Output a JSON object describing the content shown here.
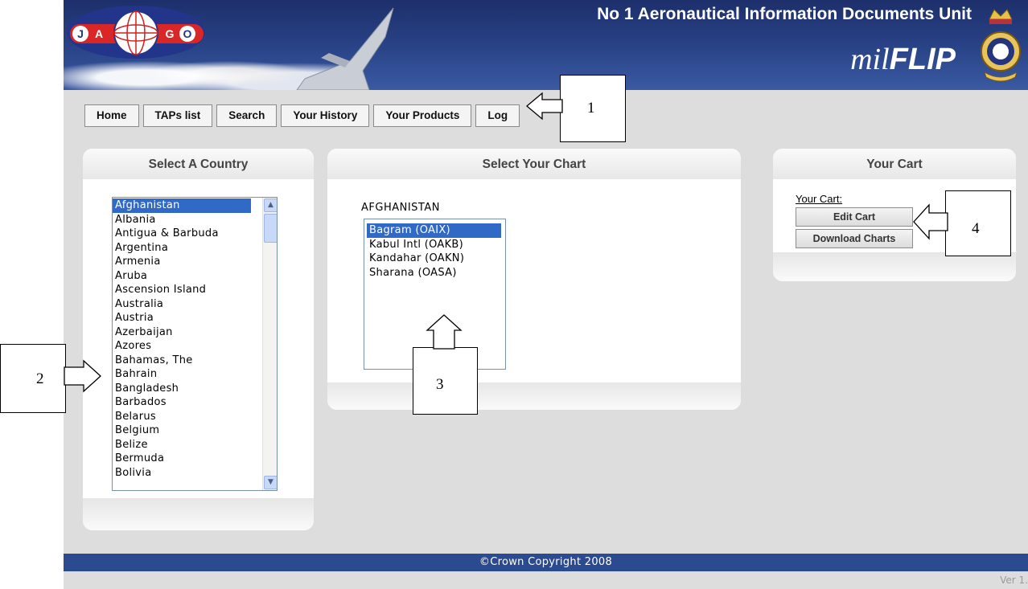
{
  "header": {
    "logo_letters": [
      "J",
      "A",
      "G",
      "O"
    ],
    "title": "No 1 Aeronautical Information Documents Unit",
    "brand_prefix": "mil",
    "brand_suffix": "FLIP"
  },
  "nav": {
    "items": [
      "Home",
      "TAPs list",
      "Search",
      "Your History",
      "Your Products",
      "Log"
    ]
  },
  "country_panel": {
    "title": "Select A Country",
    "selected": "Afghanistan",
    "options": [
      "Afghanistan",
      "Albania",
      "Antigua & Barbuda",
      "Argentina",
      "Armenia",
      "Aruba",
      "Ascension Island",
      "Australia",
      "Austria",
      "Azerbaijan",
      "Azores",
      "Bahamas, The",
      "Bahrain",
      "Bangladesh",
      "Barbados",
      "Belarus",
      "Belgium",
      "Belize",
      "Bermuda",
      "Bolivia"
    ]
  },
  "chart_panel": {
    "title": "Select Your Chart",
    "country": "AFGHANISTAN",
    "selected": "Bagram (OAIX)",
    "options": [
      "Bagram (OAIX)",
      "Kabul Intl (OAKB)",
      "Kandahar (OAKN)",
      "Sharana (OASA)"
    ]
  },
  "cart_panel": {
    "title": "Your Cart",
    "label": "Your Cart:",
    "edit_label": "Edit Cart",
    "download_label": "Download Charts"
  },
  "footer": {
    "copyright": "©Crown Copyright 2008",
    "version": "Ver 1."
  },
  "annotations": {
    "one": "1",
    "two": "2",
    "three": "3",
    "four": "4"
  },
  "colors": {
    "header_blue": "#2a4488",
    "footer_blue": "#2c4a8f",
    "selection_blue": "#3169c6",
    "page_gray": "#dddddd"
  }
}
